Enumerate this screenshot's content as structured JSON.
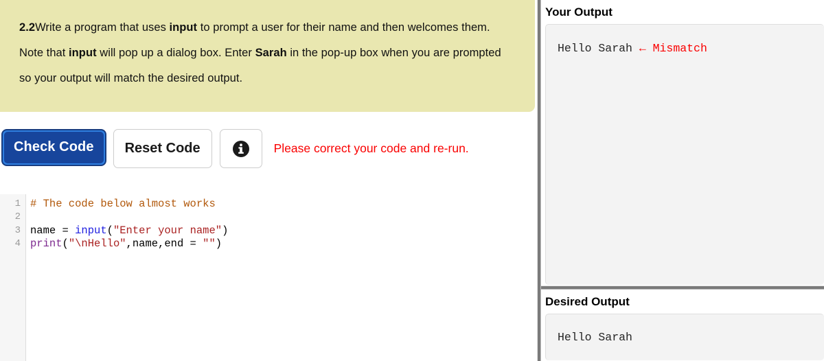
{
  "exercise": {
    "number": "2.2",
    "text_part1": "Write a program that uses ",
    "bold1": "input",
    "text_part2": " to prompt a user for their name and then welcomes them. Note that ",
    "bold2": "input",
    "text_part3": " will pop up a dialog box. Enter ",
    "bold3": "Sarah",
    "text_part4": " in the pop-up box when you are prompted so your output will match the desired output."
  },
  "toolbar": {
    "check_label": "Check Code",
    "reset_label": "Reset Code",
    "info_icon": "info-circle-icon",
    "status_message": "Please correct your code and re-run.",
    "status_color": "#fa0000",
    "check_button_color": "#17459c"
  },
  "editor": {
    "line_numbers": [
      "1",
      "2",
      "3",
      "4"
    ],
    "lines": [
      {
        "number": "1",
        "tokens": [
          {
            "t": "# The code below almost works",
            "c": "comment"
          }
        ]
      },
      {
        "number": "2",
        "tokens": [
          {
            "t": "",
            "c": "plain"
          }
        ]
      },
      {
        "number": "3",
        "tokens": [
          {
            "t": "name = ",
            "c": "plain"
          },
          {
            "t": "input",
            "c": "builtin"
          },
          {
            "t": "(",
            "c": "plain"
          },
          {
            "t": "\"Enter your name\"",
            "c": "string"
          },
          {
            "t": ")",
            "c": "plain"
          }
        ]
      },
      {
        "number": "4",
        "tokens": [
          {
            "t": "print",
            "c": "func"
          },
          {
            "t": "(",
            "c": "plain"
          },
          {
            "t": "\"\\nHello\"",
            "c": "string"
          },
          {
            "t": ",name,end = ",
            "c": "plain"
          },
          {
            "t": "\"\"",
            "c": "string"
          },
          {
            "t": ")",
            "c": "plain"
          }
        ]
      }
    ],
    "plain_text": "# The code below almost works\n\nname = input(\"Enter your name\")\nprint(\"\\nHello\",name,end = \"\")"
  },
  "your_output": {
    "title": "Your Output",
    "text": "Hello Sarah ",
    "mismatch_marker": "← Mismatch"
  },
  "desired_output": {
    "title": "Desired Output",
    "text": "Hello Sarah"
  }
}
